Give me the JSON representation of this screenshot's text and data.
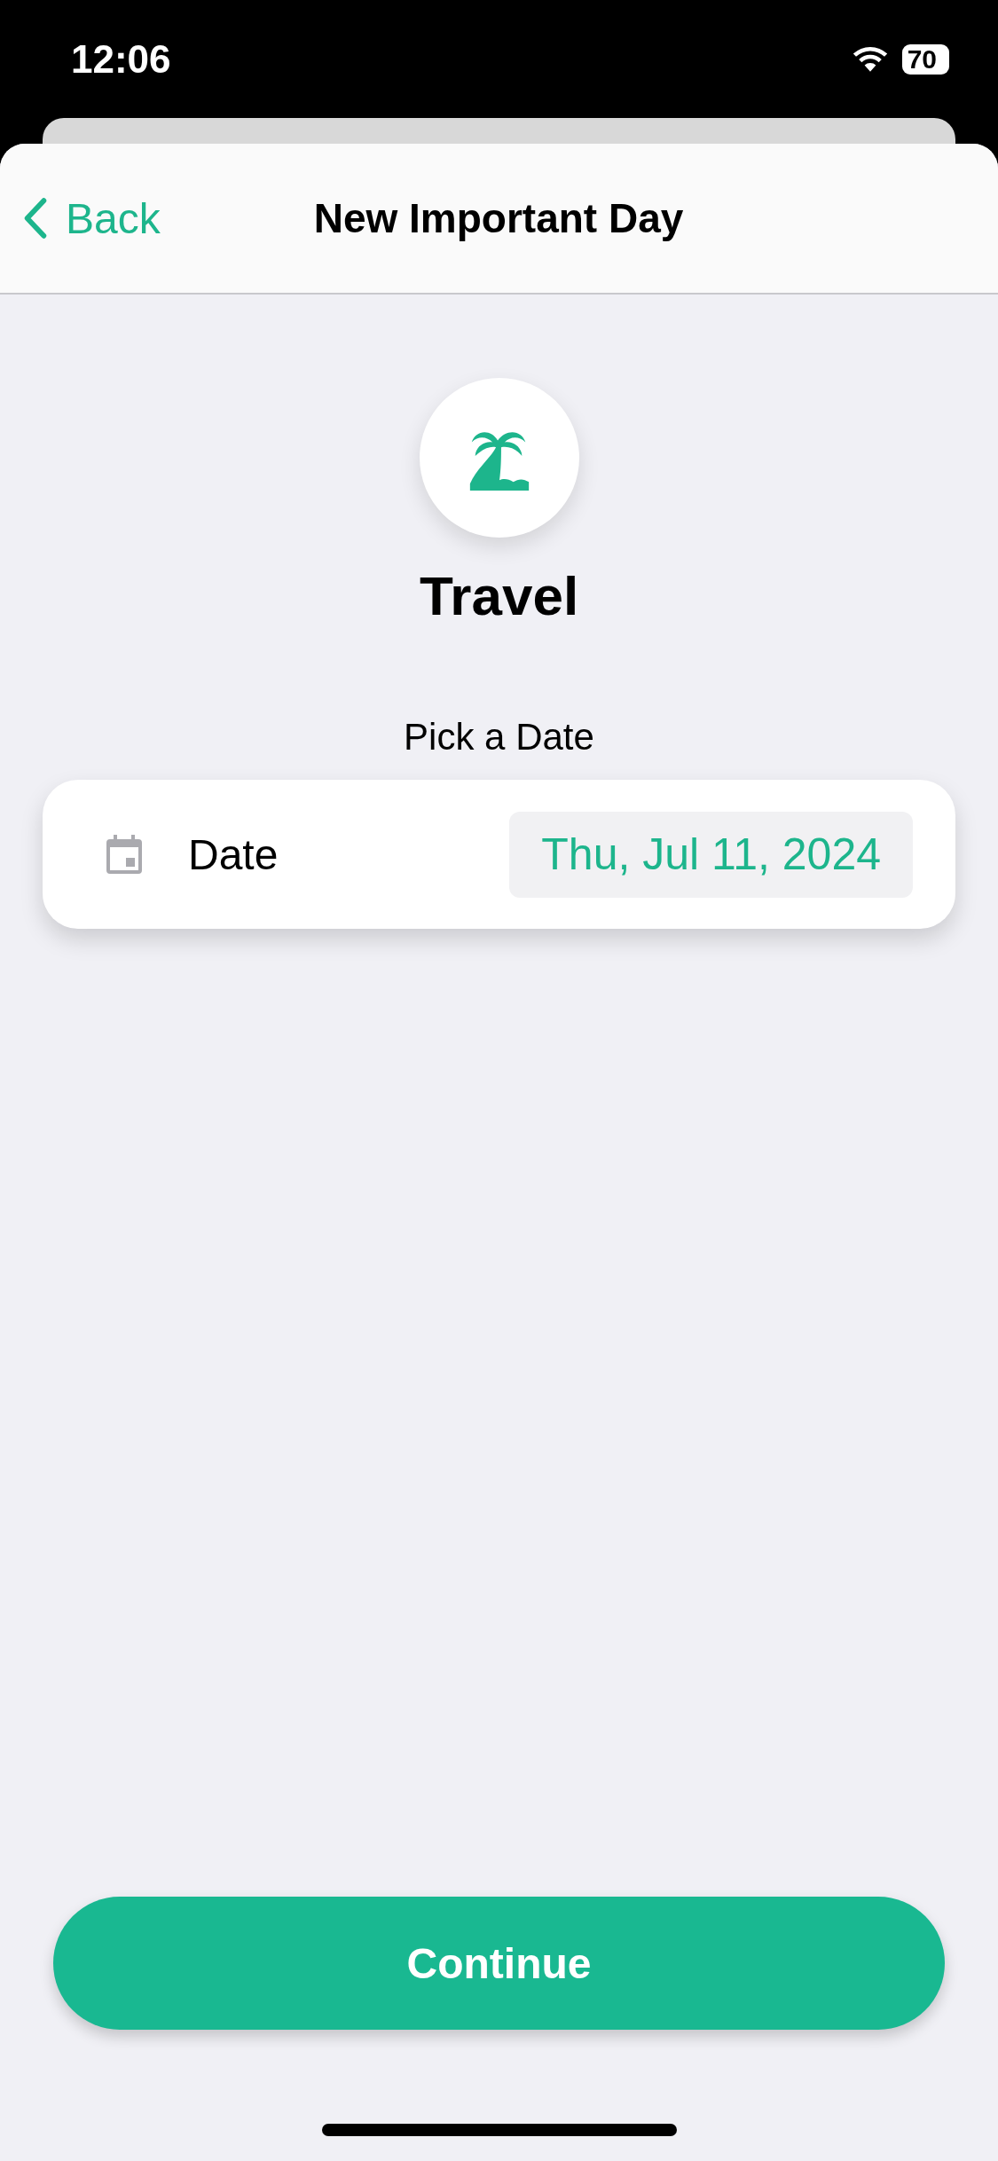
{
  "status_bar": {
    "time": "12:06",
    "battery": "70"
  },
  "nav": {
    "back": "Back",
    "title": "New Important Day"
  },
  "category": {
    "name": "Travel"
  },
  "prompt": "Pick a Date",
  "date_row": {
    "label": "Date",
    "value": "Thu, Jul 11, 2024"
  },
  "buttons": [
    "Continue"
  ]
}
